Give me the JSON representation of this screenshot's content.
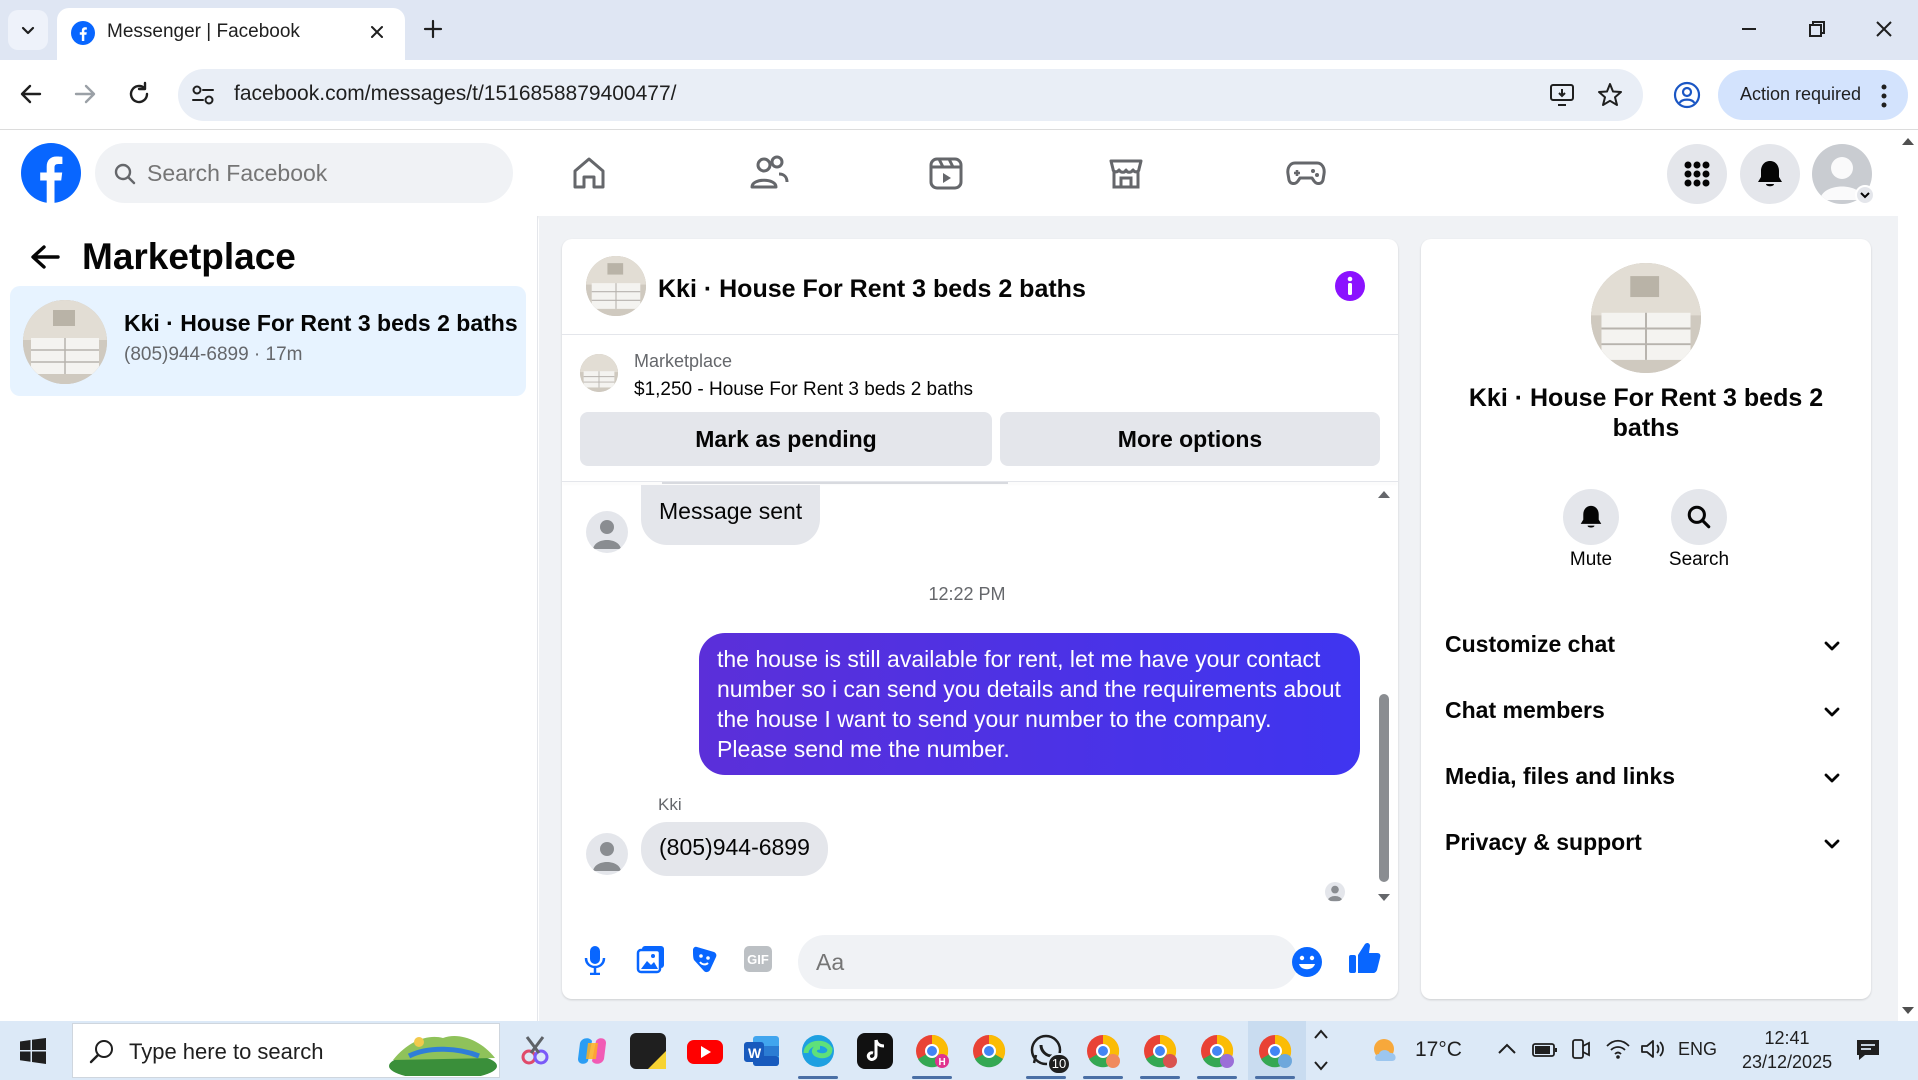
{
  "browser": {
    "tab_title": "Messenger | Facebook",
    "url": "facebook.com/messages/t/1516858879400477/",
    "action_required": "Action required"
  },
  "fb": {
    "search_placeholder": "Search Facebook",
    "brand_color": "#0866ff"
  },
  "left_panel": {
    "title": "Marketplace",
    "conversation": {
      "name": "Kki · House For Rent 3 beds 2 baths",
      "subtitle": "(805)944-6899 · 17m"
    }
  },
  "chat": {
    "title": "Kki · House For Rent 3 beds 2 baths",
    "listing_category": "Marketplace",
    "listing_title": "$1,250 - House For Rent 3 beds 2 baths",
    "mark_pending_label": "Mark as pending",
    "more_options_label": "More options",
    "messages": [
      {
        "direction": "in",
        "text": "Message sent"
      },
      {
        "direction": "time",
        "text": "12:22 PM"
      },
      {
        "direction": "out",
        "text": "the house is still available for rent, let me have your contact number so i can send you details and the requirements about the house  I want to send your number to the company. Please send me the number."
      },
      {
        "direction": "in",
        "sender": "Kki",
        "text": "(805)944-6899"
      }
    ],
    "composer_placeholder": "Aa",
    "accent_gradient": [
      "#5b2fd9",
      "#3f35f0"
    ]
  },
  "info_panel": {
    "name": "Kki · House For Rent 3 beds 2 baths",
    "mute_label": "Mute",
    "search_label": "Search",
    "sections": [
      "Customize chat",
      "Chat members",
      "Media, files and links",
      "Privacy & support"
    ]
  },
  "taskbar": {
    "search_placeholder": "Type here to search",
    "temperature": "17°C",
    "language": "ENG",
    "time": "12:41",
    "date": "23/12/2025",
    "whatsapp_badge": "10"
  }
}
